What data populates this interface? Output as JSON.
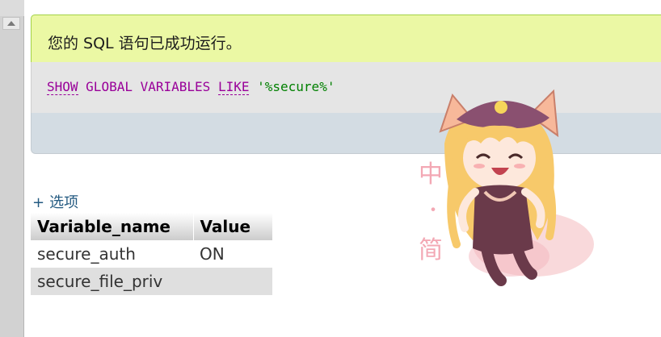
{
  "success_message": "您的 SQL 语句已成功运行。",
  "sql": {
    "keywords": [
      "SHOW",
      "GLOBAL",
      "VARIABLES",
      "LIKE"
    ],
    "string": "'%secure%'"
  },
  "options_link": {
    "plus": "+",
    "label": "选项"
  },
  "table": {
    "headers": [
      "Variable_name",
      "Value"
    ],
    "rows": [
      [
        "secure_auth",
        "ON"
      ],
      [
        "secure_file_priv",
        ""
      ]
    ]
  },
  "watermark": {
    "text": "中・简"
  },
  "colors": {
    "success_bg": "#ebf8a4",
    "sql_bg": "#e5e5e5",
    "tools_bg": "#d3dce3",
    "keyword": "#990099",
    "string": "#008000",
    "link": "#235a81"
  }
}
